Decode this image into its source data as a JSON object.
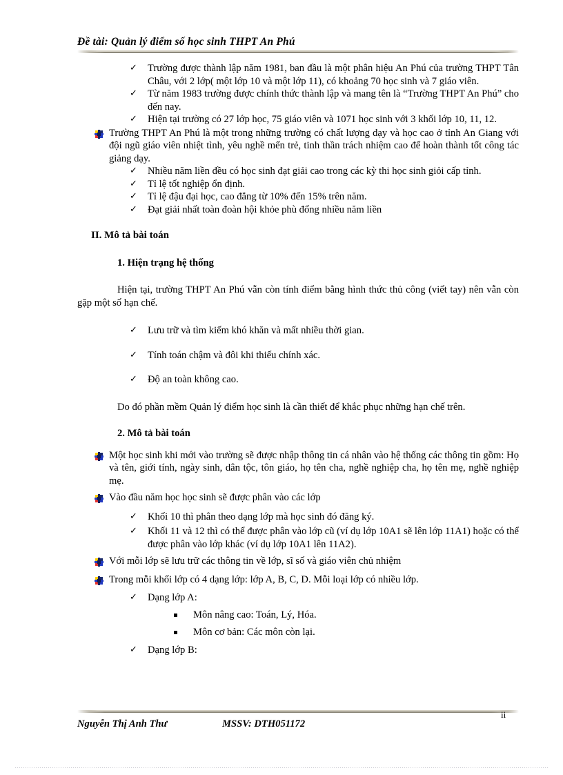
{
  "header": {
    "title": "Đề tài: Quản lý điểm số học sinh THPT An Phú"
  },
  "markers": {
    "check": "✓",
    "pinwheel": "pinwheel-bullet",
    "square": "square-bullet"
  },
  "intro_list": [
    "Trường được thành lập năm 1981, ban đầu là một phân hiệu An Phú của trường THPT Tân Châu, với 2 lớp( một lớp 10 và một lớp 11), có khoảng 70 học sinh và 7 giáo viên.",
    "Từ năm 1983 trường được chính thức thành lập và mang tên là “Trường THPT An Phú” cho đến nay.",
    "Hiện tại trường có 27 lớp học, 75 giáo viên và 1071 học sinh với 3 khối lớp 10, 11, 12."
  ],
  "quality_para": "Trường THPT An Phú là một trong những trường có chất lượng dạy và học cao ở tỉnh An Giang với đội ngũ giáo viên nhiệt tình, yêu nghề mến trẻ, tinh thần trách nhiệm cao để hoàn thành tốt công tác giảng dạy.",
  "quality_list": [
    "Nhiều năm liền đều có học sinh đạt giải cao trong các kỳ thi học sinh giỏi cấp tỉnh.",
    "Tỉ lệ tốt nghiệp ổn định.",
    "Tỉ lệ đậu đại học, cao đẳng từ 10% đến 15% trên năm.",
    "Đạt giải nhất toàn đoàn hội khỏe phù đổng nhiều năm liền"
  ],
  "section2": {
    "heading": "II.  Mô tả bài toán",
    "sub1_heading": "1. Hiện trạng hệ thống",
    "sub1_para": "Hiện tại, trường THPT An Phú vẫn còn tính điểm bằng hình thức thủ công (viết tay) nên vẫn còn gặp một số hạn chế.",
    "sub1_list": [
      "Lưu trữ và tìm kiếm khó khăn và mất nhiều thời gian.",
      "Tính toán chậm và đôi khi thiếu chính xác.",
      "Độ an toàn không cao."
    ],
    "sub1_closing": "Do đó phần mềm Quản lý điểm học sinh là cần thiết để khắc phục những hạn chế trên.",
    "sub2_heading": "2. Mô tả bài toán",
    "sub2_items": [
      "Một học sinh khi mới vào trường sẽ được nhập thông tin cá nhân vào hệ thống các thông tin gồm: Họ và tên, giới tính, ngày sinh, dân tộc, tôn giáo, họ tên cha, nghề nghiệp cha, họ tên mẹ, nghề nghiệp mẹ.",
      "Vào đầu năm học học sinh sẽ được phân vào các lớp",
      "Với mỗi lớp sẽ lưu trữ các thông tin về lớp, sĩ số và giáo viên chủ nhiệm",
      "Trong mỗi khối lớp có 4 dạng lớp: lớp A, B, C, D. Mỗi loại lớp có nhiều lớp."
    ],
    "class_assign_list": [
      "Khối 10 thì phân theo dạng lớp mà học sinh đó đăng ký.",
      "Khối 11 và 12 thì có thể được phân vào lớp cũ (ví dụ lớp 10A1 sẽ lên lớp 11A1) hoặc có thể được phân vào lớp khác (ví dụ lớp 10A1 lên 11A2)."
    ],
    "class_type_a": "Dạng lớp A:",
    "class_type_a_subjects": [
      "Môn nâng cao: Toán, Lý, Hóa.",
      "Môn cơ bản: Các môn còn lại."
    ],
    "class_type_b": "Dạng lớp B:"
  },
  "footer": {
    "author": "Nguyễn Thị Anh Thư",
    "student_id": "MSSV: DTH051172",
    "page_number": "ii"
  }
}
